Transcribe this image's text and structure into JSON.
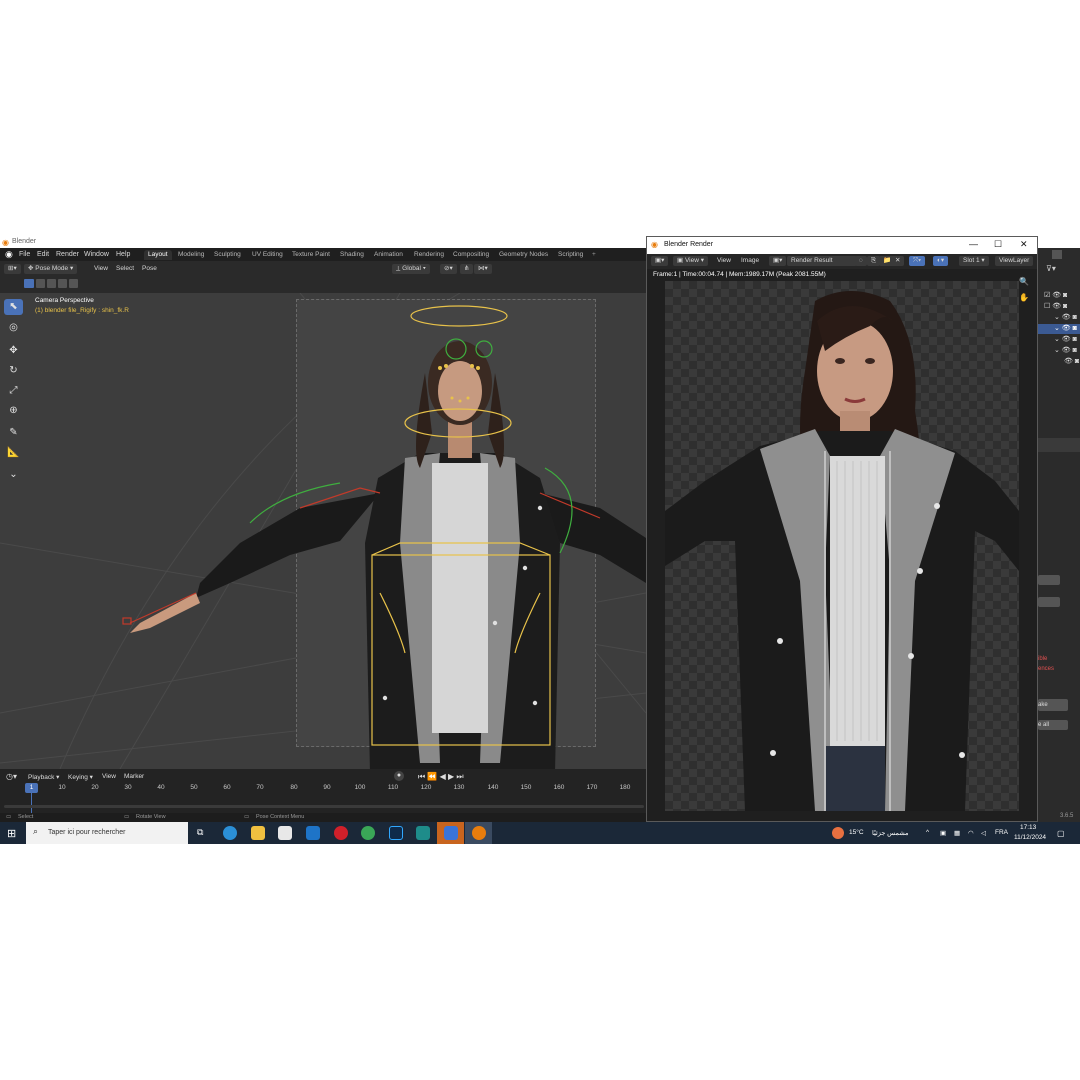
{
  "app": {
    "title": "Blender",
    "version": "3.6.5"
  },
  "menubar": {
    "items": [
      "File",
      "Edit",
      "Render",
      "Window",
      "Help"
    ],
    "workspaces": [
      "Layout",
      "Modeling",
      "Sculpting",
      "UV Editing",
      "Texture Paint",
      "Shading",
      "Animation",
      "Rendering",
      "Compositing",
      "Geometry Nodes",
      "Scripting"
    ],
    "active_workspace": "Layout",
    "add_tab": "+"
  },
  "viewport_header": {
    "mode": "Pose Mode",
    "menus": [
      "View",
      "Select",
      "Pose"
    ],
    "orientation": "Global"
  },
  "viewport": {
    "camera_label": "Camera Perspective",
    "object_label": "(1) blender file_Rigify : shin_fk.R"
  },
  "timeline": {
    "menus": [
      "Playback",
      "Keying",
      "View",
      "Marker"
    ],
    "current_frame": "1",
    "ticks": [
      "10",
      "20",
      "30",
      "40",
      "50",
      "60",
      "70",
      "80",
      "90",
      "100",
      "110",
      "120",
      "130",
      "140",
      "150",
      "160",
      "170",
      "180"
    ]
  },
  "statusbar": {
    "items": [
      "Select",
      "Rotate View",
      "Pose Context Menu"
    ]
  },
  "render_window": {
    "title": "Blender Render",
    "menus": [
      "View",
      "View",
      "Image"
    ],
    "image_name": "Render Result",
    "slot": "Slot 1",
    "view_layer": "ViewLayer",
    "info": "Frame:1 | Time:00:04.74 | Mem:1989.17M (Peak 2081.55M)"
  },
  "right_panel": {
    "fragments": [
      "ible",
      "ences",
      "ake",
      "e all"
    ]
  },
  "taskbar": {
    "search_placeholder": "Taper ici pour rechercher",
    "weather_temp": "15°C",
    "weather_text": "مشمس جزئيًا",
    "language": "FRA",
    "time": "17:13",
    "date": "11/12/2024"
  },
  "colors": {
    "accent": "#4a72b8",
    "rig_yellow": "#e8c24a",
    "rig_green": "#3fae3f",
    "rig_red": "#c23a2a"
  }
}
